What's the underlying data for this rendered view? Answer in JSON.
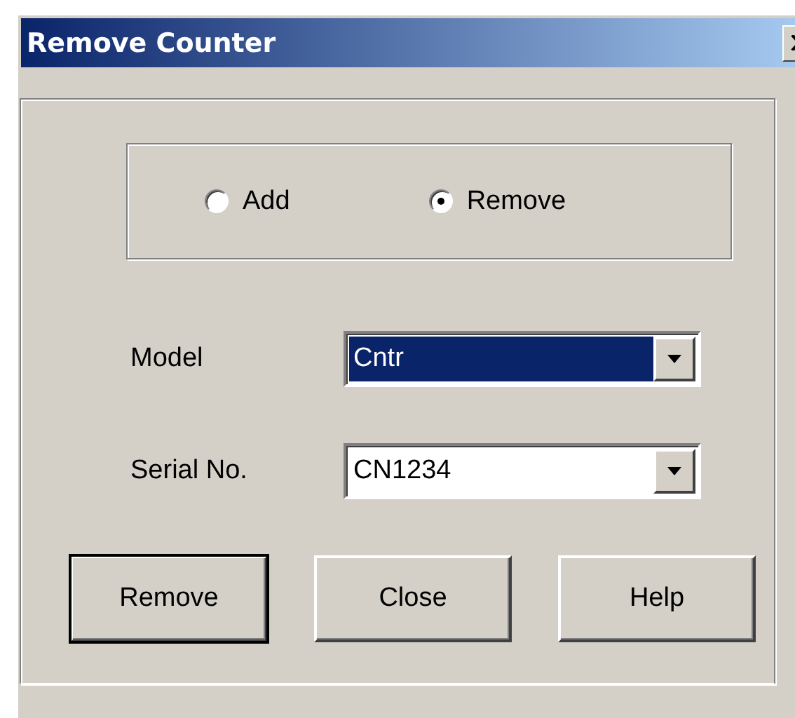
{
  "window": {
    "title": "Remove Counter"
  },
  "mode_options": [
    {
      "label": "Add",
      "selected": false
    },
    {
      "label": "Remove",
      "selected": true
    }
  ],
  "fields": [
    {
      "label": "Model",
      "value": "Cntr",
      "focused": true
    },
    {
      "label": "Serial No.",
      "value": "CN1234",
      "focused": false
    }
  ],
  "buttons": [
    {
      "label": "Remove",
      "default": true
    },
    {
      "label": "Close",
      "default": false
    },
    {
      "label": "Help",
      "default": false
    }
  ]
}
